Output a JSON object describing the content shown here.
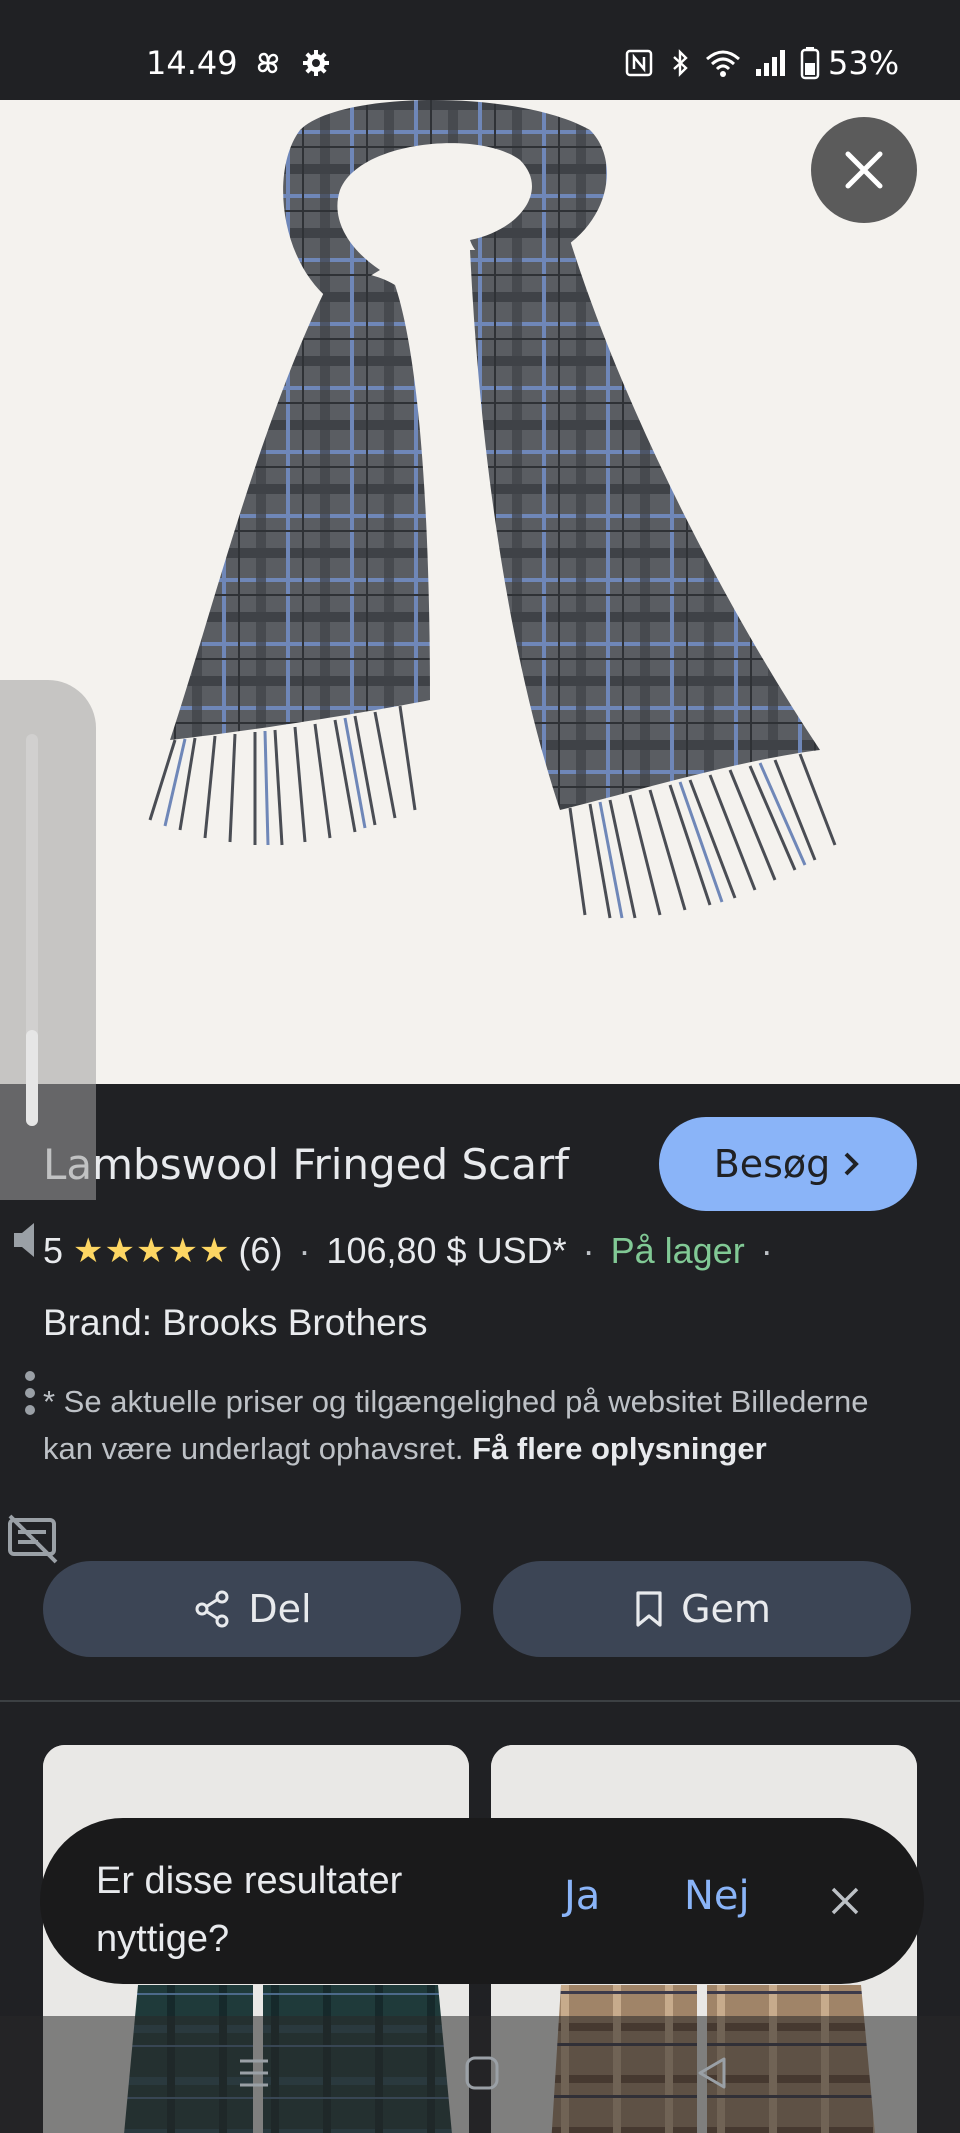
{
  "status_bar": {
    "time": "14.49",
    "battery": "53%",
    "icons": [
      "pinwheel-icon",
      "settings-gear-icon",
      "nfc-icon",
      "bluetooth-icon",
      "wifi-icon",
      "signal-icon",
      "battery-icon"
    ]
  },
  "product": {
    "title": "Lambswool Fringed Scarf",
    "visit_label": "Besøg",
    "rating": "5",
    "stars": "★★★★★",
    "review_count": "(6)",
    "price": "106,80 $ USD*",
    "availability": "På lager",
    "brand": "Brand: Brooks Brothers",
    "disclaimer": "* Se aktuelle priser og tilgængelighed på websitet Billederne kan være underlagt ophavsret.",
    "more_info": "Få flere oplysninger"
  },
  "actions": {
    "share_label": "Del",
    "save_label": "Gem"
  },
  "feedback": {
    "question": "Er disse resultater nyttige?",
    "yes": "Ja",
    "no": "Nej"
  },
  "colors": {
    "accent": "#8ab4f8",
    "in_stock": "#81c995",
    "star": "#fdd663",
    "background": "#202124"
  }
}
